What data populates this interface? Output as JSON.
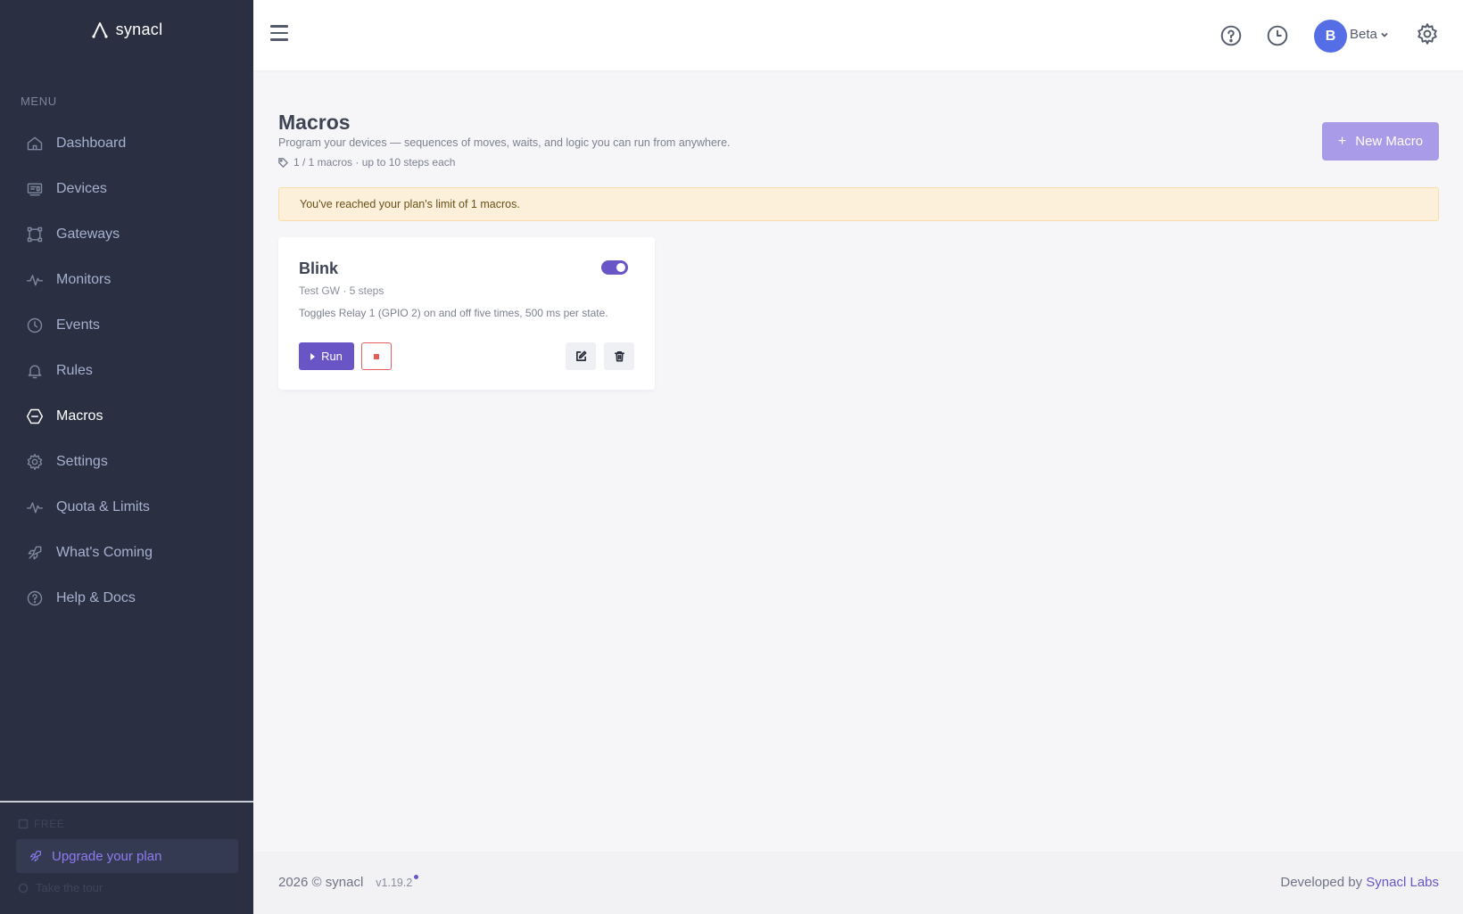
{
  "brand": {
    "name": "synacl"
  },
  "sidebar": {
    "menu_title": "MENU",
    "items": [
      {
        "label": "Dashboard",
        "icon": "home-icon"
      },
      {
        "label": "Devices",
        "icon": "devices-icon"
      },
      {
        "label": "Gateways",
        "icon": "gateway-icon"
      },
      {
        "label": "Monitors",
        "icon": "pulse-icon"
      },
      {
        "label": "Events",
        "icon": "clock-icon"
      },
      {
        "label": "Rules",
        "icon": "bell-icon"
      },
      {
        "label": "Macros",
        "icon": "hexagon-icon",
        "active": true
      },
      {
        "label": "Settings",
        "icon": "gear-icon"
      },
      {
        "label": "Quota & Limits",
        "icon": "pulse-icon"
      },
      {
        "label": "What's Coming",
        "icon": "rocket-icon"
      },
      {
        "label": "Help & Docs",
        "icon": "help-icon"
      }
    ],
    "plan_tier": "FREE",
    "upgrade_label": "Upgrade your plan",
    "tour_label": "Take the tour"
  },
  "topbar": {
    "user_initial": "B",
    "user_name": "Beta",
    "icons": [
      "menu-icon",
      "help-icon",
      "clock-icon",
      "gear-icon"
    ]
  },
  "page": {
    "title": "Macros",
    "subtitle": "Program your devices — sequences of moves, waits, and logic you can run from anywhere.",
    "meta": "1 / 1 macros · up to 10 steps each",
    "new_button_label": "New Macro",
    "alert": "You've reached your plan's limit of 1 macros."
  },
  "macros": [
    {
      "name": "Blink",
      "enabled": true,
      "meta": "Test GW · 5 steps",
      "description": "Toggles Relay 1 (GPIO 2) on and off five times, 500 ms per state.",
      "run_label": "Run"
    }
  ],
  "footer": {
    "copyright": "2026 © synacl",
    "version": "v1.19.2",
    "developed_by": "Developed by",
    "developer_link": "Synacl Labs"
  },
  "colors": {
    "sidebar_bg": "#2a3042",
    "accent": "#6a55c7",
    "avatar": "#556ee6",
    "alert_bg": "#fcf0db",
    "danger": "#e35d5d"
  }
}
